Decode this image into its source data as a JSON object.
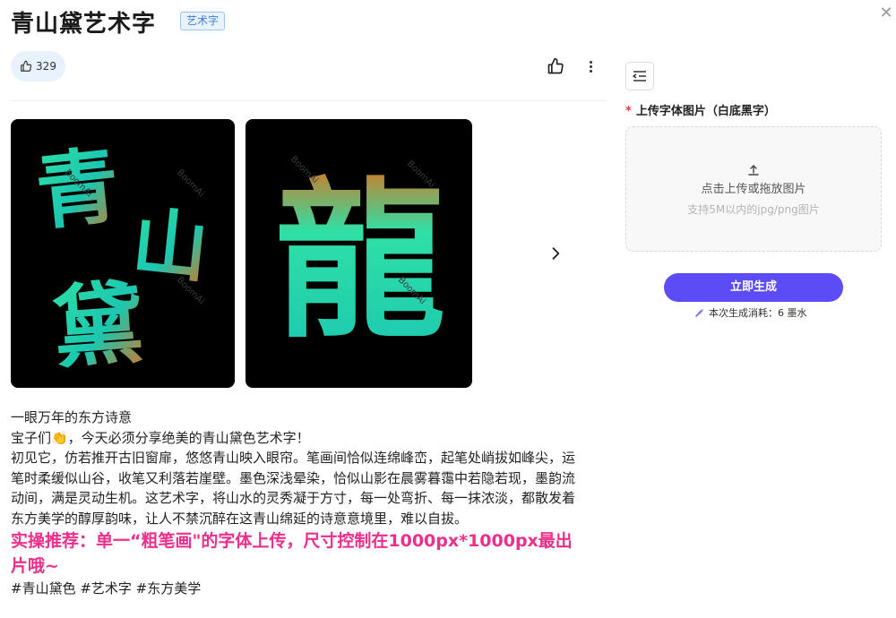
{
  "header": {
    "title": "青山黛艺术字",
    "tag": "艺术字",
    "close_icon": "close-icon"
  },
  "toolbar": {
    "like_count": "329",
    "thumb_icon": "thumbs-up-icon",
    "more_icon": "more-vertical-icon"
  },
  "gallery": {
    "images": [
      {
        "chars": [
          "青",
          "山",
          "黛"
        ],
        "watermark": "BoomAi"
      },
      {
        "chars": [
          "龍"
        ],
        "watermark": "BoomAi"
      }
    ],
    "next_icon": "chevron-right-icon",
    "colors": {
      "green": "#2fe0a6",
      "teal": "#1bc7b0",
      "orange": "#e0701a"
    }
  },
  "description": {
    "line1": "一眼万年的东方诗意",
    "line2": "宝子们👏，今天必须分享绝美的青山黛色艺术字！",
    "paragraph": "初见它，仿若推开古旧窗扉，悠悠青山映入眼帘。笔画间恰似连绵峰峦，起笔处峭拔如峰尖，运笔时柔缓似山谷，收笔又利落若崖壁。墨色深浅晕染，恰似山影在晨雾暮霭中若隐若现，墨韵流动间，满是灵动生机。这艺术字，将山水的灵秀凝于方寸，每一处弯折、每一抹浓淡，都散发着东方美学的醇厚韵味，让人不禁沉醉在这青山绵延的诗意意境里，难以自拔。",
    "highlight": "实操推荐：单一“粗笔画\"的字体上传，尺寸控制在1000px*1000px最出片哦~",
    "tags": "#青山黛色 #艺术字 #东方美学"
  },
  "side_panel": {
    "toggle_icon": "collapse-panel-icon",
    "upload_label": "上传字体图片（白底黑字）",
    "upload_required_mark": "*",
    "upload_main": "点击上传或拖放图片",
    "upload_hint": "支持5M以内的jpg/png图片",
    "generate_button": "立即生成",
    "cost_text": "本次生成消耗：6 墨水",
    "accent_color": "#5b4cf5"
  }
}
